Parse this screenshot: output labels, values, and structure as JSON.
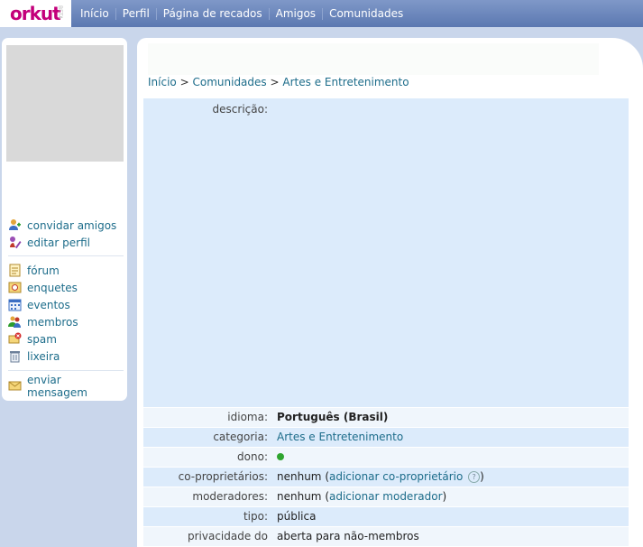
{
  "brand": {
    "logo": "orkut",
    "beta": "BETA"
  },
  "nav": [
    "Início",
    "Perfil",
    "Página de recados",
    "Amigos",
    "Comunidades"
  ],
  "sidebar": {
    "actions": [
      {
        "label": "convidar amigos",
        "icon": "add-user-icon"
      },
      {
        "label": "editar perfil",
        "icon": "edit-icon"
      }
    ],
    "tools": [
      {
        "label": "fórum",
        "icon": "forum-icon"
      },
      {
        "label": "enquetes",
        "icon": "poll-icon"
      },
      {
        "label": "eventos",
        "icon": "calendar-icon"
      },
      {
        "label": "membros",
        "icon": "members-icon"
      },
      {
        "label": "spam",
        "icon": "spam-icon"
      },
      {
        "label": "lixeira",
        "icon": "trash-icon"
      }
    ],
    "message": {
      "label": "enviar mensagem",
      "icon": "mail-icon"
    }
  },
  "breadcrumb": {
    "items": [
      "Início",
      "Comunidades",
      "Artes e Entretenimento"
    ],
    "separator": ">"
  },
  "details": {
    "descricao_label": "descrição:",
    "idioma_label": "idioma:",
    "idioma_value": "Português (Brasil)",
    "categoria_label": "categoria:",
    "categoria_value": "Artes e Entretenimento",
    "dono_label": "dono:",
    "coprop_label": "co-proprietários:",
    "coprop_none": "nenhum",
    "coprop_link": "adicionar co-proprietário",
    "moderadores_label": "moderadores:",
    "moderadores_none": "nenhum",
    "moderadores_link": "adicionar moderador",
    "tipo_label": "tipo:",
    "tipo_value": "pública",
    "privacidade_label": "privacidade do",
    "privacidade_value": "aberta para não-membros"
  },
  "colors": {
    "accent": "#c3007a",
    "topbar": "#6d86bd",
    "link": "#1c6c8a",
    "row": "#dcebfb",
    "online": "#2fa52f"
  }
}
